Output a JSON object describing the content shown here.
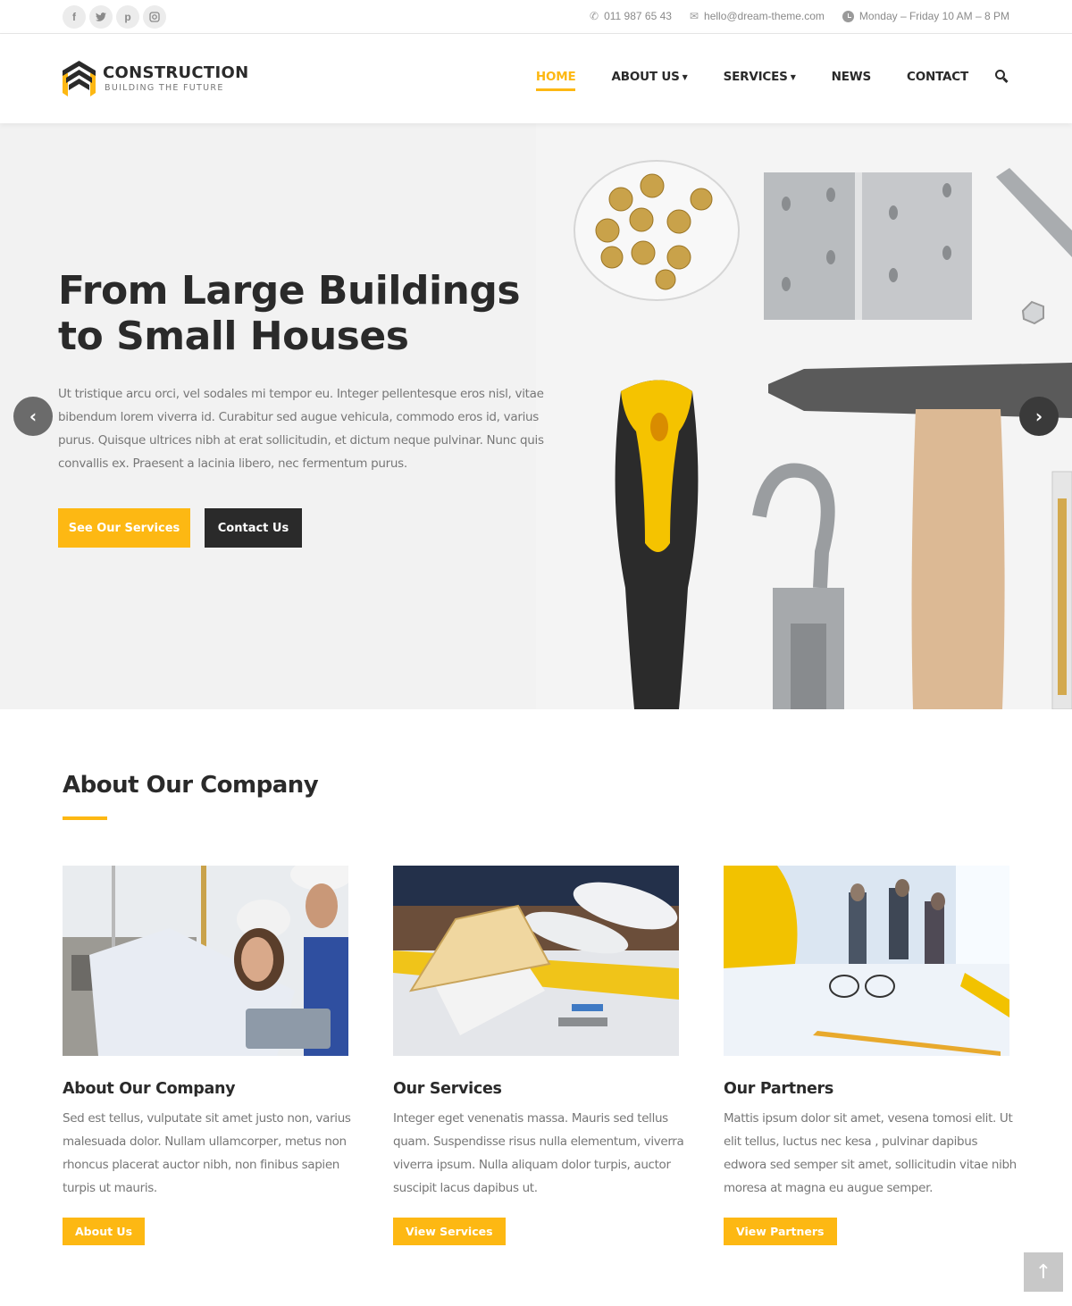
{
  "topbar": {
    "socials": [
      {
        "name": "facebook-icon",
        "glyph": "f"
      },
      {
        "name": "twitter-icon",
        "glyph": "t"
      },
      {
        "name": "pinterest-icon",
        "glyph": "p"
      },
      {
        "name": "instagram-icon",
        "glyph": "◎"
      }
    ],
    "phone": "011 987 65 43",
    "email": "hello@dream-theme.com",
    "hours": "Monday – Friday 10 AM – 8 PM"
  },
  "header": {
    "brand": "CONSTRUCTION",
    "tagline": "BUILDING THE FUTURE",
    "nav": [
      {
        "label": "HOME",
        "active": true
      },
      {
        "label": "ABOUT US",
        "dropdown": true
      },
      {
        "label": "SERVICES",
        "dropdown": true
      },
      {
        "label": "NEWS"
      },
      {
        "label": "CONTACT"
      }
    ]
  },
  "hero": {
    "title_line1": "From Large Buildings",
    "title_line2": "to Small Houses",
    "text": "Ut tristique arcu orci, vel sodales mi tempor eu. Integer pellentesque eros nisl, vitae bibendum lorem viverra id. Curabitur sed augue vehicula, commodo eros id, varius purus. Quisque ultrices nibh at erat sollicitudin, et dictum neque pulvinar. Nunc quis convallis ex. Praesent a lacinia libero, nec fermentum purus.",
    "primary_button": "See Our Services",
    "secondary_button": "Contact Us",
    "prev_glyph": "‹",
    "next_glyph": "›"
  },
  "about": {
    "title": "About Our Company",
    "cards": [
      {
        "title": "About Our Company",
        "text": "Sed est tellus, vulputate sit amet justo non, varius malesuada dolor. Nullam ullamcorper, metus non rhoncus placerat auctor nibh, non finibus sapien turpis ut mauris.",
        "button": "About Us"
      },
      {
        "title": "Our Services",
        "text": "Integer eget venenatis massa. Mauris sed tellus quam. Suspendisse risus nulla elementum, viverra viverra ipsum. Nulla aliquam dolor turpis, auctor suscipit lacus dapibus ut.",
        "button": "View Services"
      },
      {
        "title": "Our Partners",
        "text": "Mattis ipsum dolor sit amet, vesena tomosi elit. Ut elit tellus, luctus nec kesa , pulvinar dapibus edwora sed semper sit amet, sollicitudin vitae nibh moresa at magna eu augue semper.",
        "button": "View Partners"
      }
    ]
  },
  "back_to_top": "↑",
  "colors": {
    "accent": "#fdb813",
    "dark": "#2a2a2a",
    "text_muted": "#777777"
  }
}
